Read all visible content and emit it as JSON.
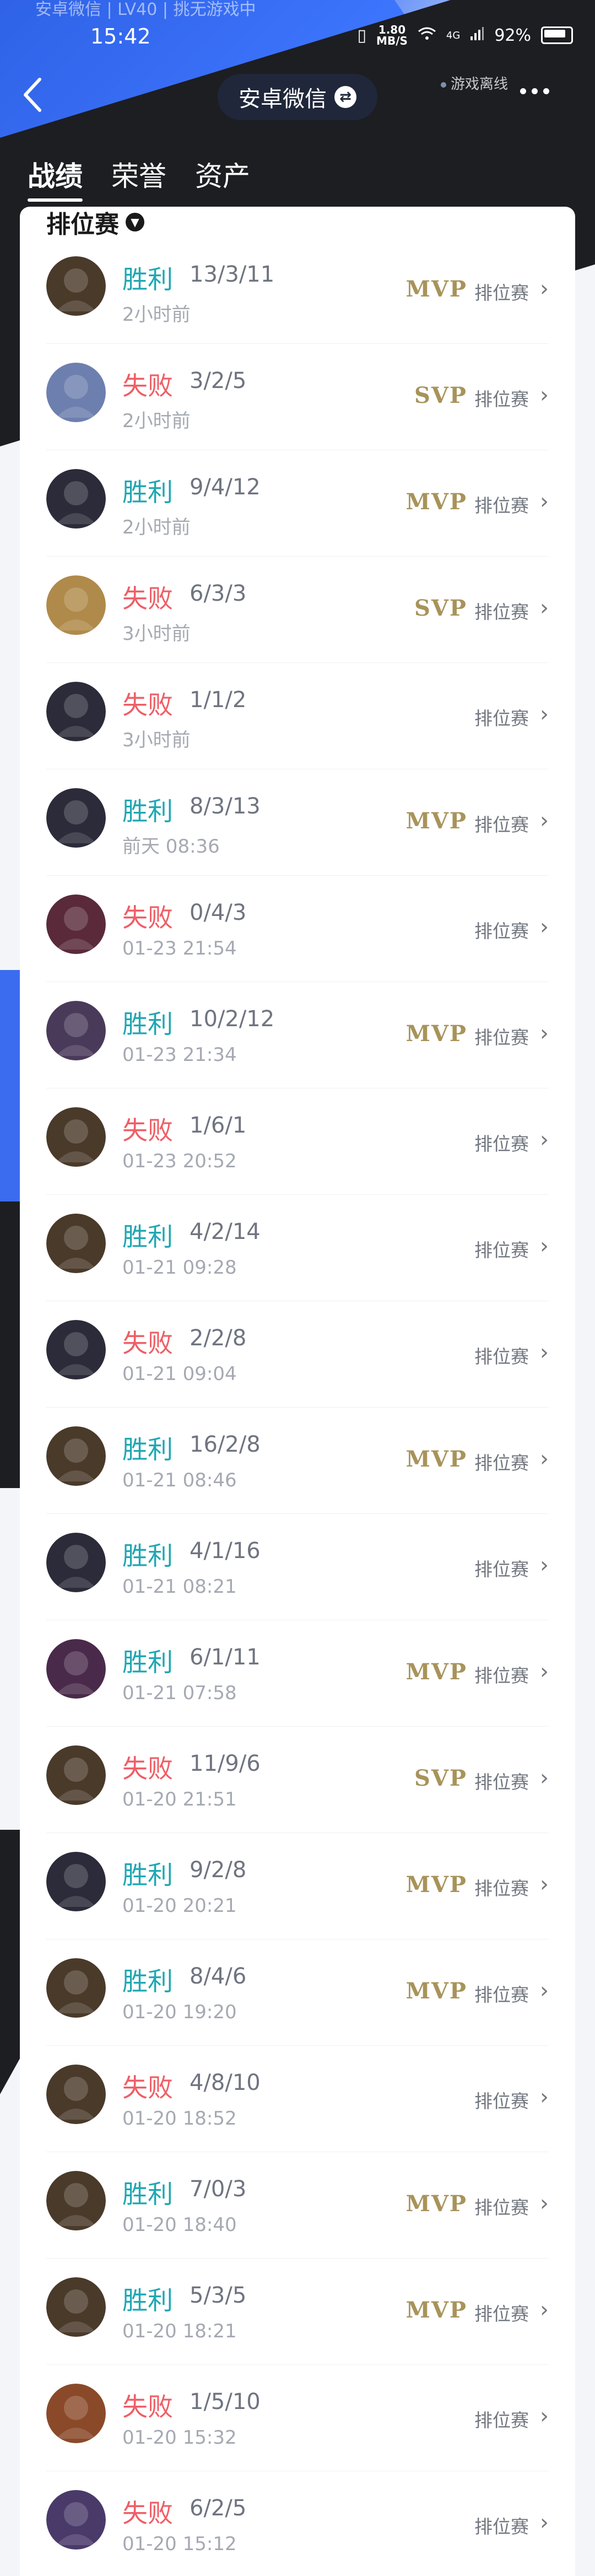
{
  "status_bar": {
    "notification": "安卓微信 | LV40 | 挑无游戏中",
    "time": "15:42",
    "net_speed": "1.80\nMB/S",
    "network": "4G",
    "battery": "92%"
  },
  "header": {
    "title": "安卓微信",
    "offline_label": "游戏离线"
  },
  "tabs": [
    {
      "label": "战绩"
    },
    {
      "label": "荣誉"
    },
    {
      "label": "资产"
    }
  ],
  "filter": {
    "label": "排位赛"
  },
  "colors": {
    "win": "#1fa7b3",
    "loss": "#ef5e66",
    "badge": "#a8935a",
    "bg_blue": "#3e76ff",
    "bg_dark": "#1d1e22"
  },
  "matches": [
    {
      "result": "胜利",
      "type": "win",
      "kda": "13/3/11",
      "time": "2小时前",
      "badge": "MVP",
      "mode": "排位赛",
      "avatar_color": "#4a3a2a"
    },
    {
      "result": "失败",
      "type": "loss",
      "kda": "3/2/5",
      "time": "2小时前",
      "badge": "SVP",
      "mode": "排位赛",
      "avatar_color": "#6d7fae"
    },
    {
      "result": "胜利",
      "type": "win",
      "kda": "9/4/12",
      "time": "2小时前",
      "badge": "MVP",
      "mode": "排位赛",
      "avatar_color": "#2b2b3a"
    },
    {
      "result": "失败",
      "type": "loss",
      "kda": "6/3/3",
      "time": "3小时前",
      "badge": "SVP",
      "mode": "排位赛",
      "avatar_color": "#b08a4a"
    },
    {
      "result": "失败",
      "type": "loss",
      "kda": "1/1/2",
      "time": "3小时前",
      "badge": "",
      "mode": "排位赛",
      "avatar_color": "#2b2b3a"
    },
    {
      "result": "胜利",
      "type": "win",
      "kda": "8/3/13",
      "time": "前天 08:36",
      "badge": "MVP",
      "mode": "排位赛",
      "avatar_color": "#2b2b3a"
    },
    {
      "result": "失败",
      "type": "loss",
      "kda": "0/4/3",
      "time": "01-23 21:54",
      "badge": "",
      "mode": "排位赛",
      "avatar_color": "#5a2a3a"
    },
    {
      "result": "胜利",
      "type": "win",
      "kda": "10/2/12",
      "time": "01-23 21:34",
      "badge": "MVP",
      "mode": "排位赛",
      "avatar_color": "#4a3a5a"
    },
    {
      "result": "失败",
      "type": "loss",
      "kda": "1/6/1",
      "time": "01-23 20:52",
      "badge": "",
      "mode": "排位赛",
      "avatar_color": "#4a3a2a"
    },
    {
      "result": "胜利",
      "type": "win",
      "kda": "4/2/14",
      "time": "01-21 09:28",
      "badge": "",
      "mode": "排位赛",
      "avatar_color": "#4a3a2a"
    },
    {
      "result": "失败",
      "type": "loss",
      "kda": "2/2/8",
      "time": "01-21 09:04",
      "badge": "",
      "mode": "排位赛",
      "avatar_color": "#2b2b3a"
    },
    {
      "result": "胜利",
      "type": "win",
      "kda": "16/2/8",
      "time": "01-21 08:46",
      "badge": "MVP",
      "mode": "排位赛",
      "avatar_color": "#4a3a2a"
    },
    {
      "result": "胜利",
      "type": "win",
      "kda": "4/1/16",
      "time": "01-21 08:21",
      "badge": "",
      "mode": "排位赛",
      "avatar_color": "#2b2b3a"
    },
    {
      "result": "胜利",
      "type": "win",
      "kda": "6/1/11",
      "time": "01-21 07:58",
      "badge": "MVP",
      "mode": "排位赛",
      "avatar_color": "#4a2a4a"
    },
    {
      "result": "失败",
      "type": "loss",
      "kda": "11/9/6",
      "time": "01-20 21:51",
      "badge": "SVP",
      "mode": "排位赛",
      "avatar_color": "#4a3a2a"
    },
    {
      "result": "胜利",
      "type": "win",
      "kda": "9/2/8",
      "time": "01-20 20:21",
      "badge": "MVP",
      "mode": "排位赛",
      "avatar_color": "#2b2b3a"
    },
    {
      "result": "胜利",
      "type": "win",
      "kda": "8/4/6",
      "time": "01-20 19:20",
      "badge": "MVP",
      "mode": "排位赛",
      "avatar_color": "#4a3a2a"
    },
    {
      "result": "失败",
      "type": "loss",
      "kda": "4/8/10",
      "time": "01-20 18:52",
      "badge": "",
      "mode": "排位赛",
      "avatar_color": "#4a3a2a"
    },
    {
      "result": "胜利",
      "type": "win",
      "kda": "7/0/3",
      "time": "01-20 18:40",
      "badge": "MVP",
      "mode": "排位赛",
      "avatar_color": "#4a3a2a"
    },
    {
      "result": "胜利",
      "type": "win",
      "kda": "5/3/5",
      "time": "01-20 18:21",
      "badge": "MVP",
      "mode": "排位赛",
      "avatar_color": "#4a3a2a"
    },
    {
      "result": "失败",
      "type": "loss",
      "kda": "1/5/10",
      "time": "01-20 15:32",
      "badge": "",
      "mode": "排位赛",
      "avatar_color": "#8a4a2a"
    },
    {
      "result": "失败",
      "type": "loss",
      "kda": "6/2/5",
      "time": "01-20 15:12",
      "badge": "",
      "mode": "排位赛",
      "avatar_color": "#4a3a6a"
    }
  ]
}
